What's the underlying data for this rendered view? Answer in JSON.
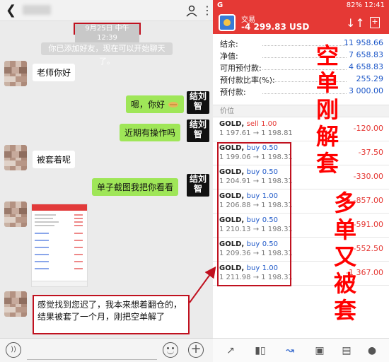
{
  "chat": {
    "header": {
      "back_icon": "back-arrow-icon",
      "title": "",
      "person_icon": "person-icon",
      "more_icon": "more-vertical-icon"
    },
    "timestamp": "9月25日 中午12:39",
    "system_message": "你已添加好友，现在可以开始聊天了。",
    "messages": [
      {
        "side": "left",
        "text": "老师你好"
      },
      {
        "side": "right",
        "text": "嗯，你好"
      },
      {
        "side": "right",
        "text": "近期有操作吗"
      },
      {
        "side": "left",
        "text": "被套着呢"
      },
      {
        "side": "right",
        "text": "单子截图我把你看看"
      },
      {
        "side": "left",
        "text": "感觉找到您迟了，我本来想着翻仓的，结果被套了一个月，刚把空单解了"
      }
    ],
    "teacher_avatar": {
      "line1": "结刘",
      "line2": "智"
    },
    "input_bar": {
      "voice_icon": "voice-icon",
      "emoji_icon": "emoji-icon",
      "plus_icon": "plus-icon"
    }
  },
  "trade": {
    "status_bar": {
      "left": "G",
      "right": "82% 12:41"
    },
    "app_title": "交易",
    "balance": "-4 299.83 USD",
    "account": [
      {
        "label": "结余:",
        "value": "11 958.66"
      },
      {
        "label": "净值:",
        "value": "7 658.83"
      },
      {
        "label": "可用预付款:",
        "value": "4 658.83"
      },
      {
        "label": "预付款比率(%):",
        "value": "255.29"
      },
      {
        "label": "预付款:",
        "value": "3 000.00"
      }
    ],
    "price_header": "价位",
    "positions": [
      {
        "symbol": "GOLD,",
        "side": "sell",
        "lots": "1.00",
        "prices": "1 197.61 → 1 198.81",
        "profit": "-120.00"
      },
      {
        "symbol": "GOLD,",
        "side": "buy",
        "lots": "0.50",
        "prices": "1 199.06 → 1 198.31",
        "profit": "-37.50"
      },
      {
        "symbol": "GOLD,",
        "side": "buy",
        "lots": "0.50",
        "prices": "1 204.91 → 1 198.31",
        "profit": "-330.00"
      },
      {
        "symbol": "GOLD,",
        "side": "buy",
        "lots": "1.00",
        "prices": "1 206.88 → 1 198.31",
        "profit": "-857.00"
      },
      {
        "symbol": "GOLD,",
        "side": "buy",
        "lots": "0.50",
        "prices": "1 210.13 → 1 198.31",
        "profit": "-591.00"
      },
      {
        "symbol": "GOLD,",
        "side": "buy",
        "lots": "0.50",
        "prices": "1 209.36 → 1 198.31",
        "profit": "-552.50"
      },
      {
        "symbol": "GOLD,",
        "side": "buy",
        "lots": "1.00",
        "prices": "1 211.98 → 1 198.31",
        "profit": "-1 367.00"
      }
    ],
    "bottom_nav": [
      "quotes-icon",
      "chart-icon",
      "trade-icon",
      "history-icon",
      "news-icon",
      "messages-icon"
    ]
  },
  "annotation": {
    "column1": [
      "空",
      "单",
      "刚",
      "解",
      "套"
    ],
    "column2": [
      "多",
      "单",
      "又",
      "被",
      "套"
    ],
    "color": "#ff0000"
  },
  "colors": {
    "accent_red": "#e53935",
    "link_blue": "#1e58c8",
    "bubble_green": "#9fe658",
    "highlight_box": "#c0111f"
  }
}
